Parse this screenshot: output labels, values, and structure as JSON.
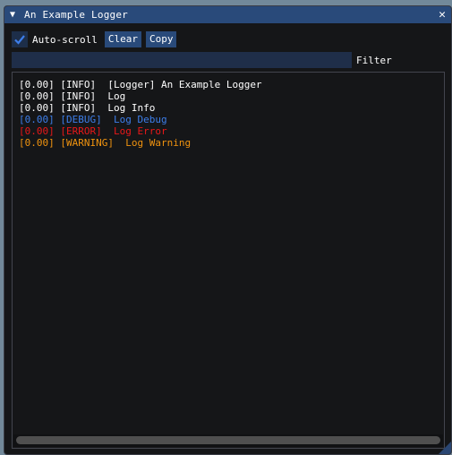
{
  "window": {
    "title": "An Example Logger",
    "collapse_icon": "▼",
    "close_icon": "✕"
  },
  "toolbar": {
    "autoscroll_label": "Auto-scroll",
    "autoscroll_checked": true,
    "clear_label": "Clear",
    "copy_label": "Copy"
  },
  "filter": {
    "value": "",
    "placeholder": "",
    "label": "Filter"
  },
  "colors": {
    "info": "#ffffff",
    "debug": "#3d7eea",
    "error": "#e81818",
    "warning": "#f0930f",
    "accent": "#294a7a"
  },
  "log": [
    {
      "time": "[0.00]",
      "level": "[INFO]",
      "message": " [Logger] An Example Logger",
      "color": "#ffffff"
    },
    {
      "time": "[0.00]",
      "level": "[INFO]",
      "message": " Log",
      "color": "#ffffff"
    },
    {
      "time": "[0.00]",
      "level": "[INFO]",
      "message": " Log Info",
      "color": "#ffffff"
    },
    {
      "time": "[0.00]",
      "level": "[DEBUG]",
      "message": " Log Debug",
      "color": "#3d7eea"
    },
    {
      "time": "[0.00]",
      "level": "[ERROR]",
      "message": " Log Error",
      "color": "#e81818"
    },
    {
      "time": "[0.00]",
      "level": "[WARNING]",
      "message": " Log Warning",
      "color": "#f0930f"
    }
  ]
}
